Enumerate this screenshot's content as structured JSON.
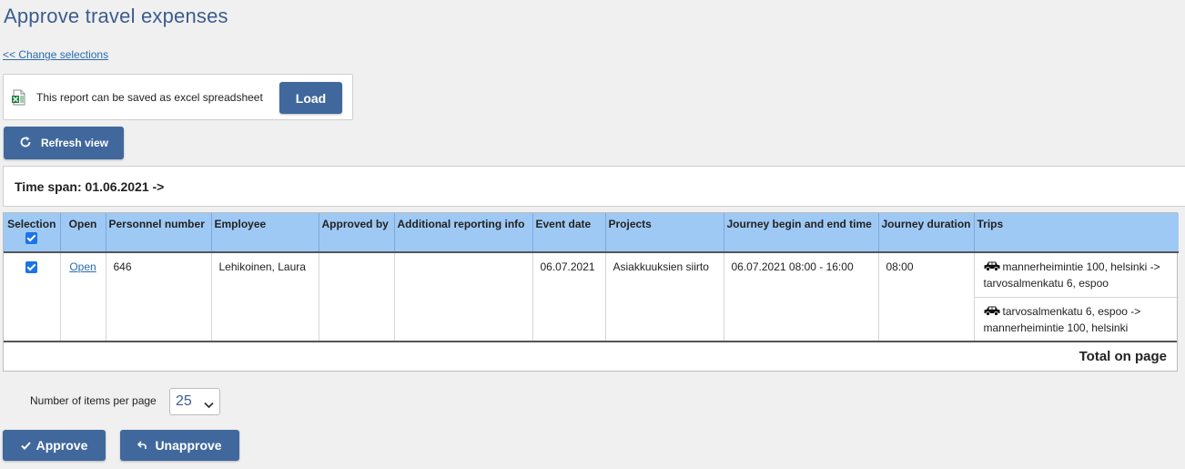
{
  "page": {
    "title": "Approve travel expenses",
    "change_selections": "<< Change selections"
  },
  "excel": {
    "text": "This report can be saved as excel spreadsheet",
    "load_label": "Load"
  },
  "toolbar": {
    "refresh_label": "Refresh view"
  },
  "timespan": {
    "text": "Time span: 01.06.2021 ->"
  },
  "table": {
    "headers": [
      "Selection",
      "Open",
      "Personnel number",
      "Employee",
      "Approved by",
      "Additional reporting info",
      "Event date",
      "Projects",
      "Journey begin and end time",
      "Journey duration",
      "Trips"
    ],
    "row": {
      "selected": true,
      "open_label": "Open",
      "personnel_number": "646",
      "employee": "Lehikoinen, Laura",
      "approved_by": "",
      "additional_info": "",
      "event_date": "06.07.2021",
      "project": "Asiakkuuksien siirto",
      "journey_time": "06.07.2021 08:00 - 16:00",
      "duration": "08:00",
      "trips": [
        {
          "icon": "car-icon",
          "text": "mannerheimintie 100, helsinki -> tarvosalmenkatu 6, espoo"
        },
        {
          "icon": "car-icon",
          "text": "tarvosalmenkatu 6, espoo -> mannerheimintie 100, helsinki"
        }
      ]
    },
    "total_label": "Total on page"
  },
  "paging": {
    "label": "Number of items per page",
    "value": "25"
  },
  "actions": {
    "approve_label": "Approve",
    "unapprove_label": "Unapprove"
  },
  "colors": {
    "accent": "#41689d",
    "header_bg": "#9fc9f5",
    "title": "#3c5d8f",
    "checkbox": "#1a73e8"
  }
}
